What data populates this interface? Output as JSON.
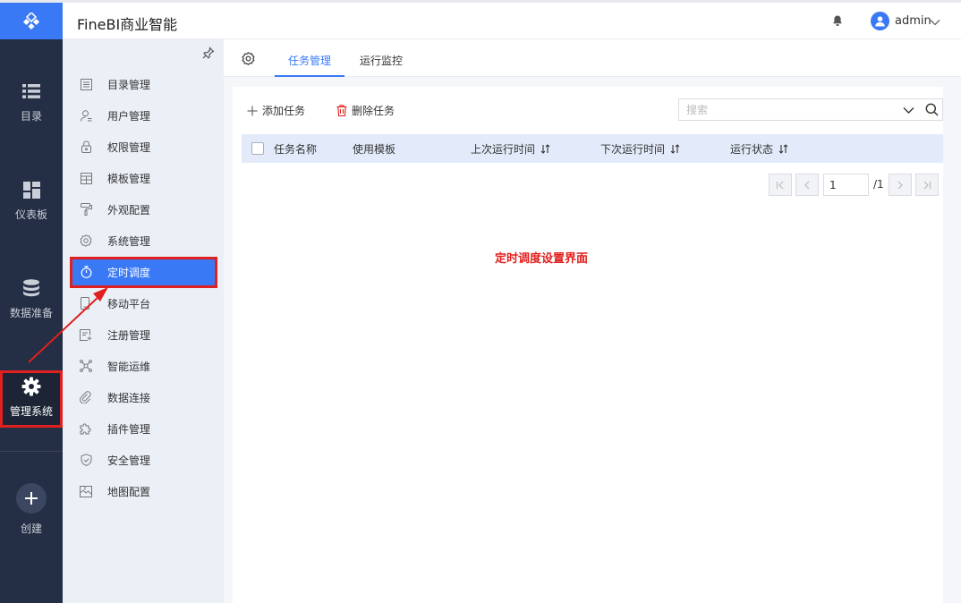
{
  "header": {
    "app_title": "FineBI商业智能",
    "username": "admin"
  },
  "leftnav": {
    "items": [
      {
        "label": "目录",
        "icon": "list-icon"
      },
      {
        "label": "仪表板",
        "icon": "dashboard-icon"
      },
      {
        "label": "数据准备",
        "icon": "database-icon"
      },
      {
        "label": "管理系统",
        "icon": "gear-icon",
        "active": true
      },
      {
        "label": "创建",
        "icon": "plus-icon"
      }
    ]
  },
  "submenu": {
    "items": [
      {
        "label": "目录管理",
        "icon": "catalog-icon"
      },
      {
        "label": "用户管理",
        "icon": "user-icon"
      },
      {
        "label": "权限管理",
        "icon": "lock-icon"
      },
      {
        "label": "模板管理",
        "icon": "template-icon"
      },
      {
        "label": "外观配置",
        "icon": "paint-roller-icon"
      },
      {
        "label": "系统管理",
        "icon": "gear-icon"
      },
      {
        "label": "定时调度",
        "icon": "stopwatch-icon",
        "active": true
      },
      {
        "label": "移动平台",
        "icon": "mobile-icon"
      },
      {
        "label": "注册管理",
        "icon": "register-icon"
      },
      {
        "label": "智能运维",
        "icon": "network-icon"
      },
      {
        "label": "数据连接",
        "icon": "link-icon"
      },
      {
        "label": "插件管理",
        "icon": "puzzle-icon"
      },
      {
        "label": "安全管理",
        "icon": "shield-icon"
      },
      {
        "label": "地图配置",
        "icon": "map-icon"
      }
    ]
  },
  "tabs": {
    "items": [
      {
        "label": "任务管理",
        "active": true
      },
      {
        "label": "运行监控"
      }
    ]
  },
  "toolbar": {
    "add_label": "添加任务",
    "delete_label": "删除任务",
    "search_placeholder": "搜索"
  },
  "table": {
    "columns": [
      "任务名称",
      "使用模板",
      "上次运行时间",
      "下次运行时间",
      "运行状态"
    ],
    "rows": []
  },
  "pagination": {
    "current_page": "1",
    "total": "/1"
  },
  "annotation": {
    "text": "定时调度设置界面",
    "color": "#e0201e"
  },
  "colors": {
    "accent": "#3a79f6",
    "nav_bg": "#242e44",
    "submenu_bg": "#ebf0f7",
    "highlight_red": "#e0201e"
  }
}
